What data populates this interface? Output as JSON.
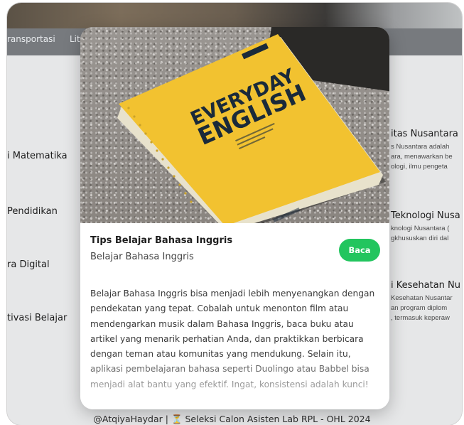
{
  "background": {
    "nav": {
      "item_1": "ransportasi",
      "item_2": "Lit"
    },
    "left_items": [
      "i Matematika",
      "Pendidikan",
      "ra Digital",
      "tivasi Belajar"
    ],
    "right_items": [
      {
        "title": "itas Nusantara",
        "desc": [
          "s Nusantara adalah",
          "ara, menawarkan be",
          "ologi, ilmu pengeta"
        ]
      },
      {
        "title": "Teknologi Nusa",
        "desc": [
          "knologi Nusantara (",
          "gkhususkan diri dal"
        ]
      },
      {
        "title": "i Kesehatan Nu",
        "desc": [
          "Kesehatan Nusantar",
          "an program diplom",
          ", termasuk keperaw"
        ]
      }
    ],
    "footer": "@AtqiyaHaydar  |  ⏳ Seleksi Calon Asisten Lab RPL - OHL 2024"
  },
  "modal": {
    "image": {
      "book_title_line1": "EVERYDAY",
      "book_title_line2": "ENGLISH",
      "colors": {
        "cover": "#f2c230",
        "text": "#1a2a3a"
      }
    },
    "title": "Tips Belajar Bahasa Inggris",
    "subtitle": "Belajar Bahasa Inggris",
    "button_label": "Baca",
    "button_color": "#22c55e",
    "description": "Belajar Bahasa Inggris bisa menjadi lebih menyenangkan dengan pendekatan yang tepat. Cobalah untuk menonton film atau mendengarkan musik dalam Bahasa Inggris, baca buku atau artikel yang menarik perhatian Anda, dan praktikkan berbicara dengan teman atau komunitas yang mendukung. Selain itu, aplikasi pembelajaran bahasa seperti Duolingo atau Babbel bisa menjadi alat bantu yang efektif. Ingat, konsistensi adalah kunci!"
  }
}
